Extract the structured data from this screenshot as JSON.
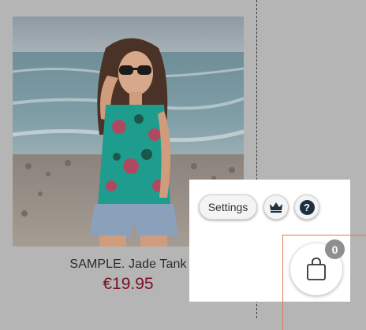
{
  "product": {
    "title": "SAMPLE. Jade Tank",
    "price": "€19.95",
    "image_icon": "beach-photo"
  },
  "toolbar": {
    "settings_label": "Settings",
    "crown_icon": "crown-icon",
    "help_glyph": "?"
  },
  "cart": {
    "count": "0",
    "icon": "shopping-bag-icon"
  },
  "colors": {
    "background": "#b5b5b5",
    "price": "#7a0f22",
    "help_icon": "#1f3140",
    "badge": "#8f8f8f",
    "frame": "#e07a55"
  }
}
